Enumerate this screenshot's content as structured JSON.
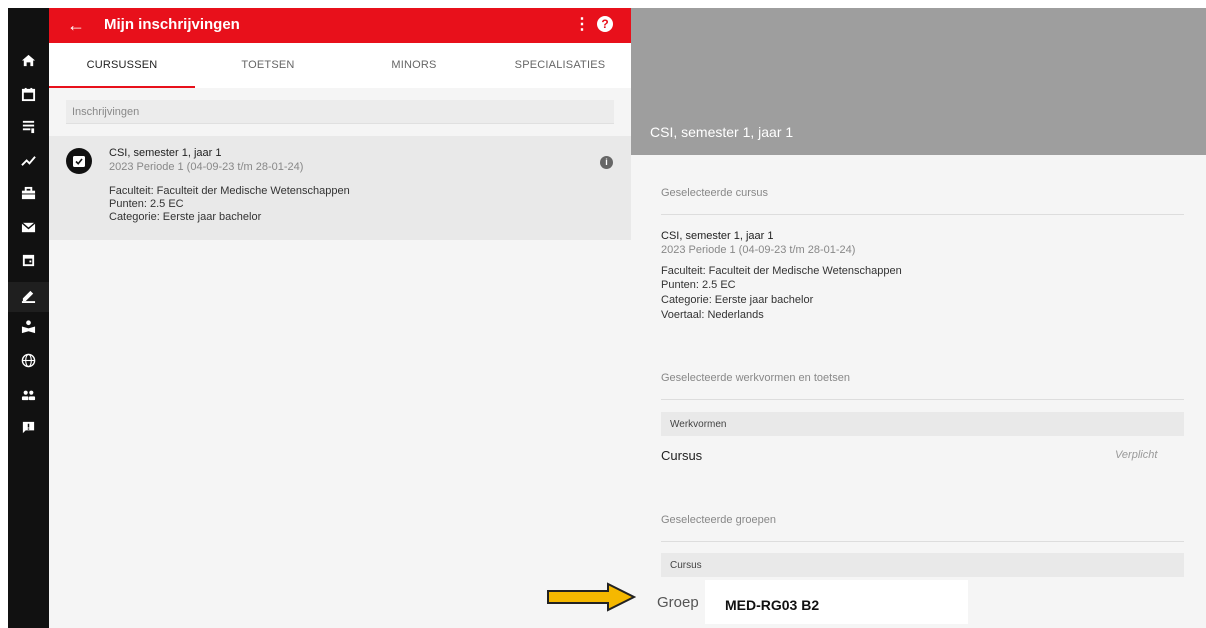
{
  "appbar": {
    "back_icon": "arrow-left-icon",
    "title": "Mijn inschrijvingen",
    "menu_icon": "kebab-icon",
    "help_icon": "help-icon",
    "help_glyph": "?",
    "accent_color": "#e8101b"
  },
  "rail": {
    "icons": [
      "home-icon",
      "calendar-icon",
      "list-icon",
      "trend-icon",
      "briefcase-icon",
      "mail-icon",
      "calendar-day-icon",
      "edit-icon",
      "learn-icon",
      "globe-icon",
      "people-icon",
      "feedback-icon"
    ],
    "active": "edit-icon"
  },
  "tabs": [
    {
      "label": "CURSUSSEN",
      "active": true
    },
    {
      "label": "TOETSEN",
      "active": false
    },
    {
      "label": "MINORS",
      "active": false
    },
    {
      "label": "SPECIALISATIES",
      "active": false
    }
  ],
  "search": {
    "placeholder": "Inschrijvingen"
  },
  "enrollment": {
    "title": "CSI, semester 1, jaar 1",
    "period": "2023 Periode 1 (04-09-23 t/m 28-01-24)",
    "faculty": "Faculteit: Faculteit der Medische Wetenschappen",
    "points": "Punten: 2.5 EC",
    "category": "Categorie: Eerste jaar bachelor",
    "info_glyph": "i"
  },
  "detail": {
    "header_title": "CSI, semester 1, jaar 1",
    "selected_course_label": "Geselecteerde cursus",
    "course_title": "CSI, semester 1, jaar 1",
    "course_period": "2023 Periode 1 (04-09-23 t/m 28-01-24)",
    "course_faculty": "Faculteit: Faculteit der Medische Wetenschappen",
    "course_points": "Punten: 2.5 EC",
    "course_category": "Categorie: Eerste jaar bachelor",
    "course_language": "Voertaal: Nederlands",
    "work_forms_label": "Geselecteerde werkvormen en toetsen",
    "work_forms_bar": "Werkvormen",
    "work_row_title": "Cursus",
    "work_row_tag": "Verplicht",
    "groups_label": "Geselecteerde groepen",
    "groups_bar": "Cursus",
    "group_label": "Groep",
    "group_value": "MED-RG03 B2"
  },
  "annotation": {
    "arrow_color": "#f5b800"
  }
}
